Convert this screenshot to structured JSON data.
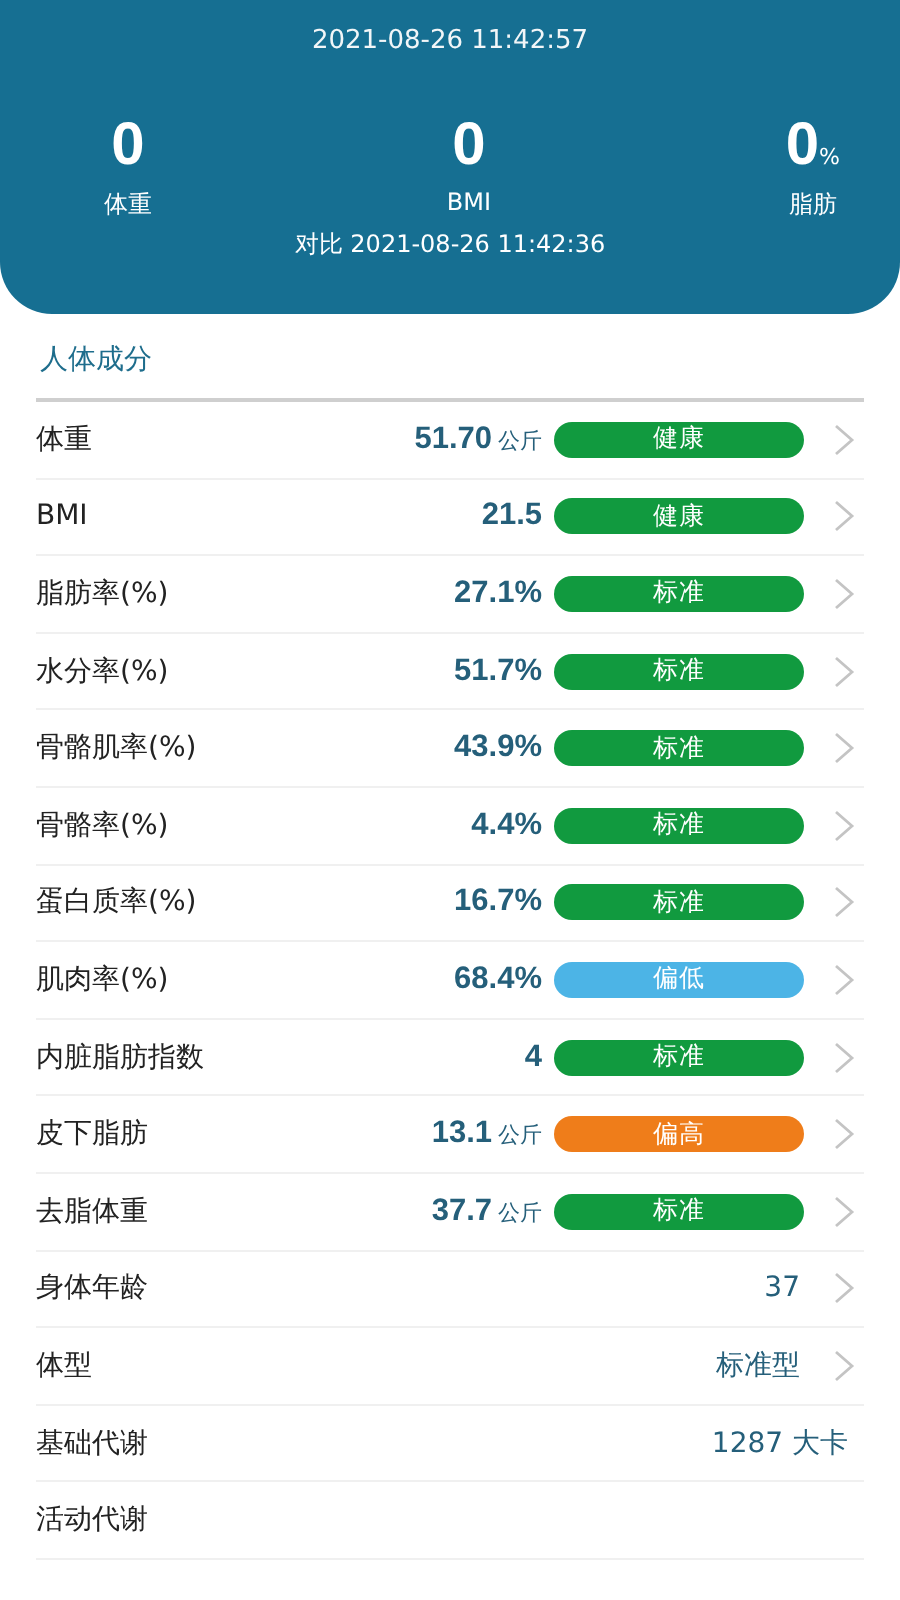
{
  "header": {
    "measured_at": "2021-08-26 11:42:57",
    "stats": [
      {
        "value": "0",
        "label": "体重"
      },
      {
        "value": "0",
        "label": "BMI"
      },
      {
        "value": "0",
        "unit": "%",
        "label": "脂肪"
      }
    ],
    "compare": "对比 2021-08-26 11:42:36"
  },
  "section_title": "人体成分",
  "rows": [
    {
      "kind": "rated",
      "label": "体重",
      "value": "51.70",
      "unit": "公斤",
      "badge": "健康",
      "color": "#119a3f"
    },
    {
      "kind": "rated",
      "label": "BMI",
      "value": "21.5",
      "badge": "健康",
      "color": "#119a3f"
    },
    {
      "kind": "rated",
      "label": "脂肪率(%)",
      "value": "27.1%",
      "badge": "标准",
      "color": "#119a3f"
    },
    {
      "kind": "rated",
      "label": "水分率(%)",
      "value": "51.7%",
      "badge": "标准",
      "color": "#119a3f"
    },
    {
      "kind": "rated",
      "label": "骨骼肌率(%)",
      "value": "43.9%",
      "badge": "标准",
      "color": "#119a3f"
    },
    {
      "kind": "rated",
      "label": "骨骼率(%)",
      "value": "4.4%",
      "badge": "标准",
      "color": "#119a3f"
    },
    {
      "kind": "rated",
      "label": "蛋白质率(%)",
      "value": "16.7%",
      "badge": "标准",
      "color": "#119a3f"
    },
    {
      "kind": "rated",
      "label": "肌肉率(%)",
      "value": "68.4%",
      "badge": "偏低",
      "color": "#4cb4e6"
    },
    {
      "kind": "rated",
      "label": "内脏脂肪指数",
      "value": "4",
      "badge": "标准",
      "color": "#119a3f"
    },
    {
      "kind": "rated",
      "label": "皮下脂肪",
      "value": "13.1",
      "unit": "公斤",
      "badge": "偏高",
      "color": "#ef7d1a"
    },
    {
      "kind": "rated",
      "label": "去脂体重",
      "value": "37.7",
      "unit": "公斤",
      "badge": "标准",
      "color": "#119a3f"
    },
    {
      "kind": "plain",
      "label": "身体年龄",
      "value": "37"
    },
    {
      "kind": "plain",
      "label": "体型",
      "value": "标准型"
    },
    {
      "kind": "info",
      "label": "基础代谢",
      "value": "1287 大卡"
    },
    {
      "kind": "empty",
      "label": "活动代谢"
    }
  ]
}
